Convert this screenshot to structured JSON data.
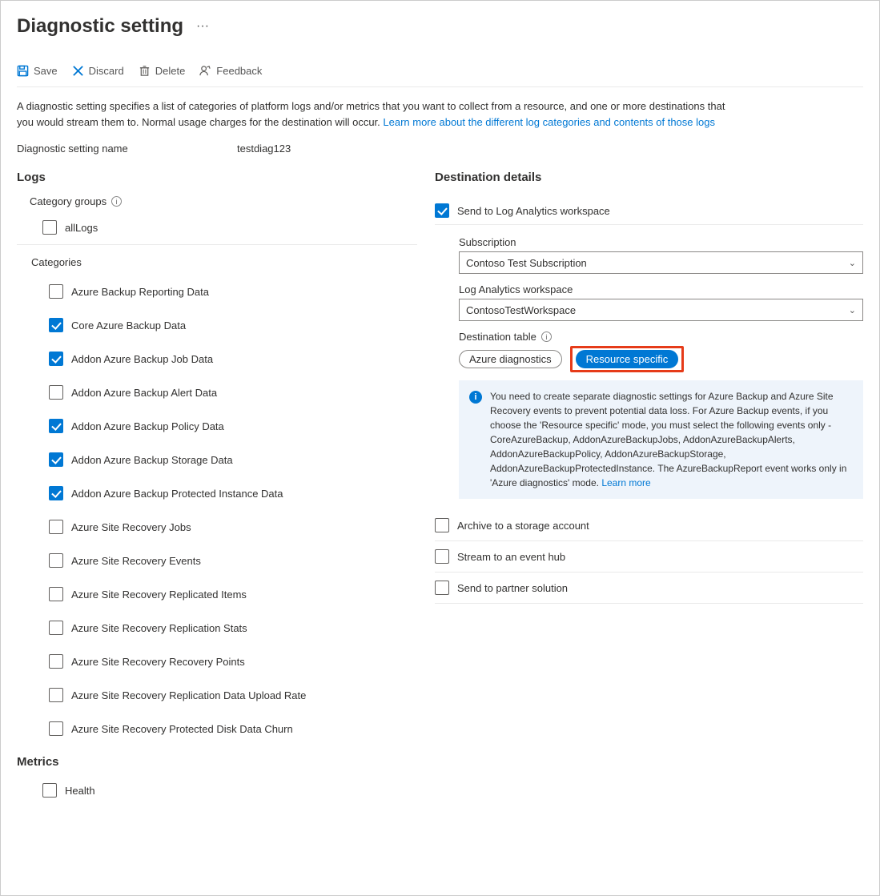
{
  "title": "Diagnostic setting",
  "toolbar": {
    "save": "Save",
    "discard": "Discard",
    "delete": "Delete",
    "feedback": "Feedback"
  },
  "description": "A diagnostic setting specifies a list of categories of platform logs and/or metrics that you want to collect from a resource, and one or more destinations that you would stream them to. Normal usage charges for the destination will occur. ",
  "description_link": "Learn more about the different log categories and contents of those logs",
  "setting_name_label": "Diagnostic setting name",
  "setting_name_value": "testdiag123",
  "logs": {
    "heading": "Logs",
    "category_groups_label": "Category groups",
    "allLogs": {
      "label": "allLogs",
      "checked": false
    },
    "categories_label": "Categories",
    "items": [
      {
        "label": "Azure Backup Reporting Data",
        "checked": false
      },
      {
        "label": "Core Azure Backup Data",
        "checked": true
      },
      {
        "label": "Addon Azure Backup Job Data",
        "checked": true
      },
      {
        "label": "Addon Azure Backup Alert Data",
        "checked": false
      },
      {
        "label": "Addon Azure Backup Policy Data",
        "checked": true
      },
      {
        "label": "Addon Azure Backup Storage Data",
        "checked": true
      },
      {
        "label": "Addon Azure Backup Protected Instance Data",
        "checked": true
      },
      {
        "label": "Azure Site Recovery Jobs",
        "checked": false
      },
      {
        "label": "Azure Site Recovery Events",
        "checked": false
      },
      {
        "label": "Azure Site Recovery Replicated Items",
        "checked": false
      },
      {
        "label": "Azure Site Recovery Replication Stats",
        "checked": false
      },
      {
        "label": "Azure Site Recovery Recovery Points",
        "checked": false
      },
      {
        "label": "Azure Site Recovery Replication Data Upload Rate",
        "checked": false
      },
      {
        "label": "Azure Site Recovery Protected Disk Data Churn",
        "checked": false
      }
    ]
  },
  "metrics": {
    "heading": "Metrics",
    "items": [
      {
        "label": "Health",
        "checked": false
      }
    ]
  },
  "destination": {
    "heading": "Destination details",
    "options": [
      {
        "key": "log_analytics",
        "label": "Send to Log Analytics workspace",
        "checked": true
      },
      {
        "key": "storage",
        "label": "Archive to a storage account",
        "checked": false
      },
      {
        "key": "eventhub",
        "label": "Stream to an event hub",
        "checked": false
      },
      {
        "key": "partner",
        "label": "Send to partner solution",
        "checked": false
      }
    ],
    "subscription_label": "Subscription",
    "subscription_value": "Contoso Test Subscription",
    "workspace_label": "Log Analytics workspace",
    "workspace_value": "ContosoTestWorkspace",
    "dest_table_label": "Destination table",
    "toggle": {
      "azure_diag": "Azure diagnostics",
      "resource_specific": "Resource specific",
      "active": "resource_specific"
    },
    "info_text": "You need to create separate diagnostic settings for Azure Backup and Azure Site Recovery events to prevent potential data loss. For Azure Backup events, if you choose the 'Resource specific' mode, you must select the following events only - CoreAzureBackup, AddonAzureBackupJobs, AddonAzureBackupAlerts, AddonAzureBackupPolicy, AddonAzureBackupStorage, AddonAzureBackupProtectedInstance. The AzureBackupReport event works only in 'Azure diagnostics' mode.  ",
    "info_link": "Learn more"
  }
}
